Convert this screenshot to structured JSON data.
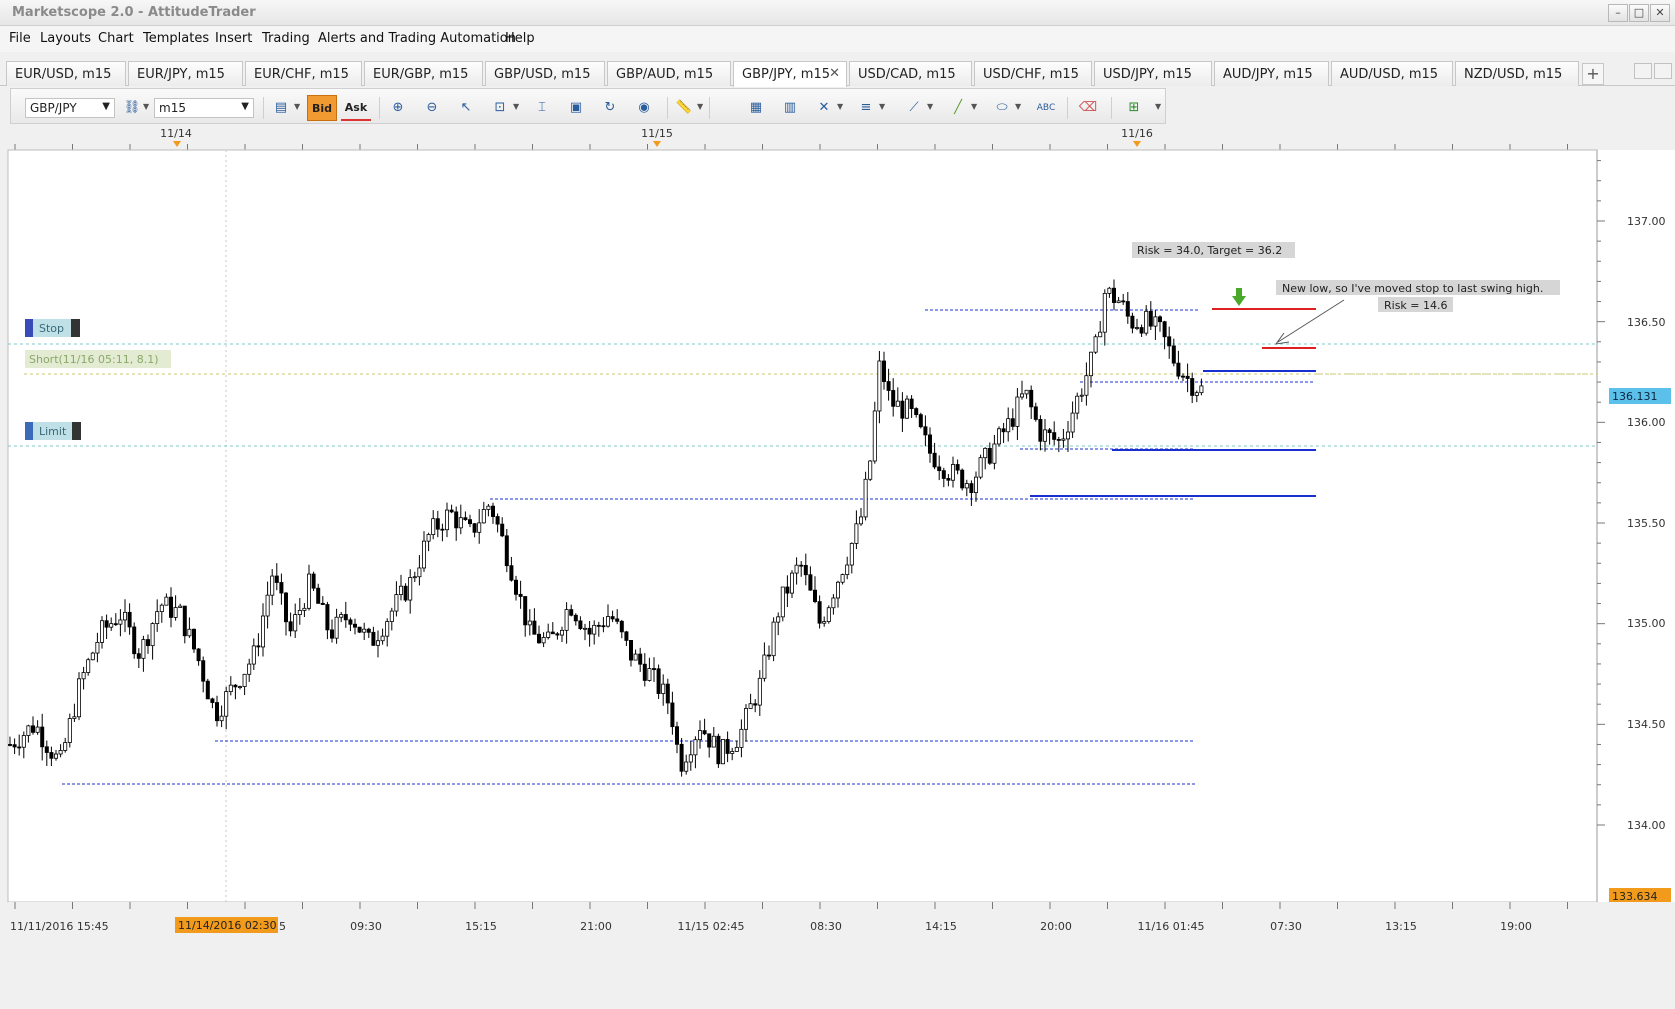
{
  "window": {
    "title": "Marketscope 2.0 - AttitudeTrader",
    "minimize": "–",
    "maximize": "□",
    "close": "✕"
  },
  "menu": [
    "File",
    "Layouts",
    "Chart",
    "Templates",
    "Insert",
    "Trading",
    "Alerts and Trading Automation",
    "Help"
  ],
  "tabs": [
    {
      "label": "EUR/USD, m15"
    },
    {
      "label": "EUR/JPY, m15"
    },
    {
      "label": "EUR/CHF, m15"
    },
    {
      "label": "EUR/GBP, m15"
    },
    {
      "label": "GBP/USD, m15"
    },
    {
      "label": "GBP/AUD, m15"
    },
    {
      "label": "GBP/JPY, m15",
      "active": true
    },
    {
      "label": "USD/CAD, m15"
    },
    {
      "label": "USD/CHF, m15"
    },
    {
      "label": "USD/JPY, m15"
    },
    {
      "label": "AUD/JPY, m15"
    },
    {
      "label": "AUD/USD, m15"
    },
    {
      "label": "NZD/USD, m15"
    }
  ],
  "tab_close": "✕",
  "tab_add": "+",
  "toolbar": {
    "instrument": "GBP/JPY",
    "timeframe": "m15",
    "bid_label": "Bid",
    "ask_label": "Ask",
    "icons": [
      "chart-type-icon",
      "bid-icon",
      "ask-icon",
      "zoom-in-icon",
      "zoom-out-icon",
      "cursor-icon",
      "zoom-range-icon",
      "data-window-icon",
      "snapshot-icon",
      "refresh-icon",
      "globe-icon",
      "ruler-icon",
      "image-icon",
      "template-icon",
      "tools-icon",
      "lines-icon",
      "trendline-icon",
      "pen-icon",
      "ellipse-icon",
      "text-icon",
      "eraser-icon",
      "hierarchy-icon"
    ]
  },
  "chart": {
    "date_markers": [
      "11/14",
      "11/15",
      "11/16"
    ],
    "price_ticks": [
      "137.00",
      "136.50",
      "136.00",
      "135.50",
      "135.00",
      "134.50",
      "134.00"
    ],
    "current_price": "136.131",
    "low_price": "133.634",
    "time_ticks": [
      "11/11/2016 15:45",
      "09:30",
      "15:15",
      "21:00",
      "11/15 02:45",
      "08:30",
      "14:15",
      "20:00",
      "11/16 01:45",
      "07:30",
      "13:15",
      "19:00"
    ],
    "cursor_time": "11/14/2016 02:30",
    "cursor_time_suffix": "5",
    "stop_label": "Stop",
    "limit_label": "Limit",
    "position_label": "Short(11/16 05:11, 8.1)",
    "annotation_risk_target": "Risk = 34.0, Target = 36.2",
    "annotation_new_low": "New low, so I've moved stop to last swing high.",
    "annotation_risk": "Risk = 14.6",
    "colors": {
      "bull": "#ffffff",
      "bear": "#000000",
      "stop": "#e02020",
      "entry": "#1a2fd0",
      "current": "#3ab0e0",
      "low": "#f29a1c"
    }
  },
  "chart_data": {
    "type": "candlestick",
    "instrument": "GBP/JPY",
    "timeframe": "m15",
    "ylim": [
      133.634,
      137.4
    ],
    "close_path": [
      [
        0,
        134.4
      ],
      [
        25,
        134.5
      ],
      [
        50,
        134.3
      ],
      [
        70,
        134.7
      ],
      [
        90,
        134.95
      ],
      [
        110,
        135.05
      ],
      [
        130,
        134.85
      ],
      [
        150,
        135.1
      ],
      [
        170,
        135.05
      ],
      [
        190,
        134.8
      ],
      [
        205,
        134.55
      ],
      [
        225,
        134.7
      ],
      [
        245,
        134.85
      ],
      [
        262,
        135.25
      ],
      [
        280,
        134.95
      ],
      [
        300,
        135.2
      ],
      [
        320,
        134.95
      ],
      [
        340,
        135.05
      ],
      [
        360,
        134.9
      ],
      [
        380,
        135.05
      ],
      [
        400,
        135.2
      ],
      [
        420,
        135.45
      ],
      [
        440,
        135.55
      ],
      [
        460,
        135.45
      ],
      [
        480,
        135.6
      ],
      [
        500,
        135.3
      ],
      [
        520,
        134.95
      ],
      [
        540,
        134.9
      ],
      [
        560,
        135.1
      ],
      [
        580,
        134.95
      ],
      [
        600,
        135.05
      ],
      [
        620,
        134.85
      ],
      [
        640,
        134.75
      ],
      [
        660,
        134.6
      ],
      [
        670,
        134.3
      ],
      [
        690,
        134.5
      ],
      [
        710,
        134.35
      ],
      [
        730,
        134.45
      ],
      [
        750,
        134.7
      ],
      [
        770,
        135.1
      ],
      [
        790,
        135.3
      ],
      [
        810,
        135.0
      ],
      [
        830,
        135.25
      ],
      [
        850,
        135.5
      ],
      [
        860,
        135.8
      ],
      [
        870,
        136.3
      ],
      [
        880,
        136.1
      ],
      [
        900,
        136.05
      ],
      [
        920,
        135.85
      ],
      [
        940,
        135.75
      ],
      [
        960,
        135.7
      ],
      [
        980,
        135.85
      ],
      [
        1000,
        136.0
      ],
      [
        1015,
        136.15
      ],
      [
        1030,
        135.95
      ],
      [
        1050,
        135.9
      ],
      [
        1070,
        136.15
      ],
      [
        1085,
        136.35
      ],
      [
        1095,
        136.65
      ],
      [
        1110,
        136.6
      ],
      [
        1120,
        136.5
      ],
      [
        1135,
        136.5
      ],
      [
        1150,
        136.45
      ],
      [
        1165,
        136.3
      ],
      [
        1180,
        136.2
      ],
      [
        1195,
        136.15
      ]
    ],
    "levels": [
      {
        "price": 136.56,
        "style": "dashed"
      },
      {
        "price": 136.4,
        "style": "dotted"
      },
      {
        "price": 136.25,
        "style": "solid-blue"
      },
      {
        "price": 136.2,
        "style": "dashed"
      },
      {
        "price": 135.85,
        "style": "solid-blue"
      },
      {
        "price": 135.62,
        "style": "solid-blue"
      },
      {
        "price": 135.6,
        "style": "dashed"
      },
      {
        "price": 134.41,
        "style": "dashed"
      },
      {
        "price": 134.2,
        "style": "dashed"
      }
    ]
  }
}
